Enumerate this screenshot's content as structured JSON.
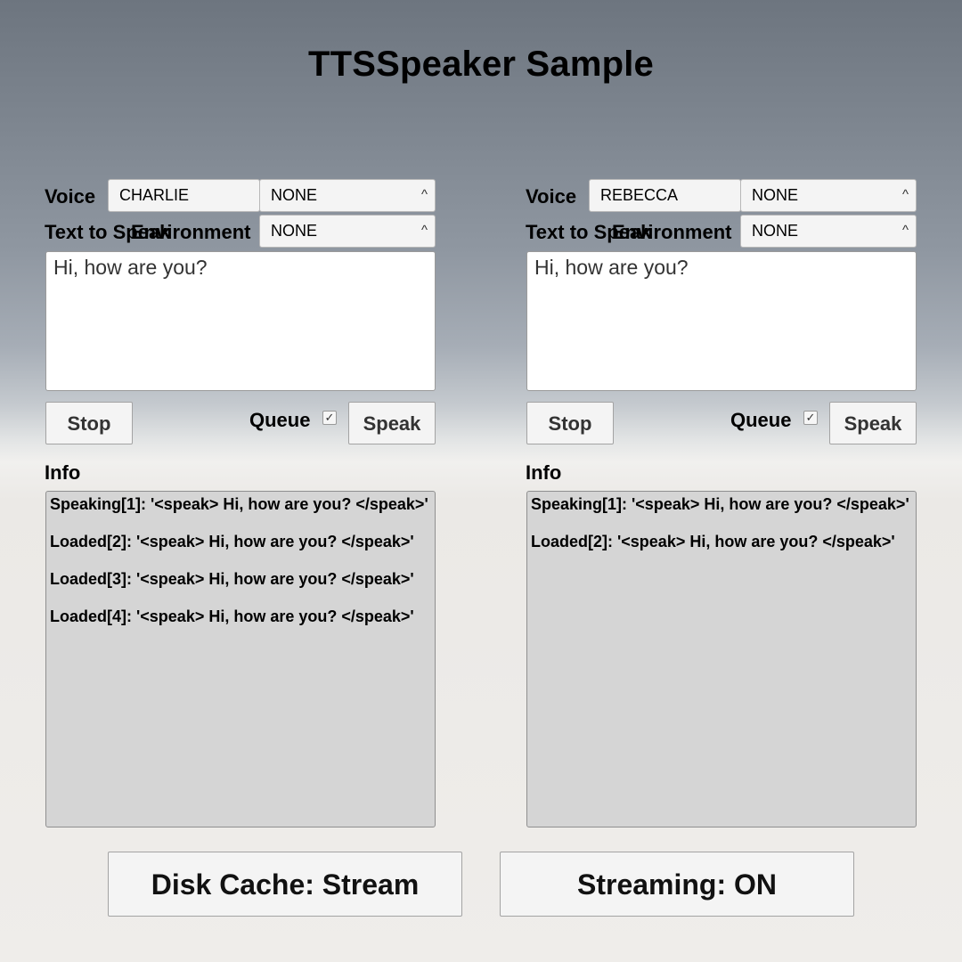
{
  "title": "TTSSpeaker Sample",
  "panels": [
    {
      "voice_label": "Voice",
      "voice_value": "CHARLIE",
      "voice_option": "NONE",
      "text_label": "Text to Speak",
      "environment_label": "Environment",
      "environment_value": "NONE",
      "text_value": "Hi, how are you?",
      "stop_label": "Stop",
      "queue_label": "Queue",
      "queue_checked": true,
      "checkbox_glyph": "✓",
      "speak_label": "Speak",
      "info_label": "Info",
      "info_lines": [
        "Speaking[1]: '<speak> Hi, how are you? </speak>'",
        "Loaded[2]: '<speak> Hi, how are you? </speak>'",
        "Loaded[3]: '<speak> Hi, how are you? </speak>'",
        "Loaded[4]: '<speak> Hi, how are you? </speak>'"
      ]
    },
    {
      "voice_label": "Voice",
      "voice_value": "REBECCA",
      "voice_option": "NONE",
      "text_label": "Text to Speak",
      "environment_label": "Environment",
      "environment_value": "NONE",
      "text_value": "Hi, how are you?",
      "stop_label": "Stop",
      "queue_label": "Queue",
      "queue_checked": true,
      "checkbox_glyph": "✓",
      "speak_label": "Speak",
      "info_label": "Info",
      "info_lines": [
        "Speaking[1]: '<speak> Hi, how are you? </speak>'",
        "Loaded[2]: '<speak> Hi, how are you? </speak>'"
      ]
    }
  ],
  "dropdown_arrow_glyph": "^",
  "disk_cache_label": "Disk Cache: Stream",
  "streaming_label": "Streaming: ON",
  "icons": {
    "dropdown": "chevron-up-icon",
    "checkbox": "check-icon"
  }
}
